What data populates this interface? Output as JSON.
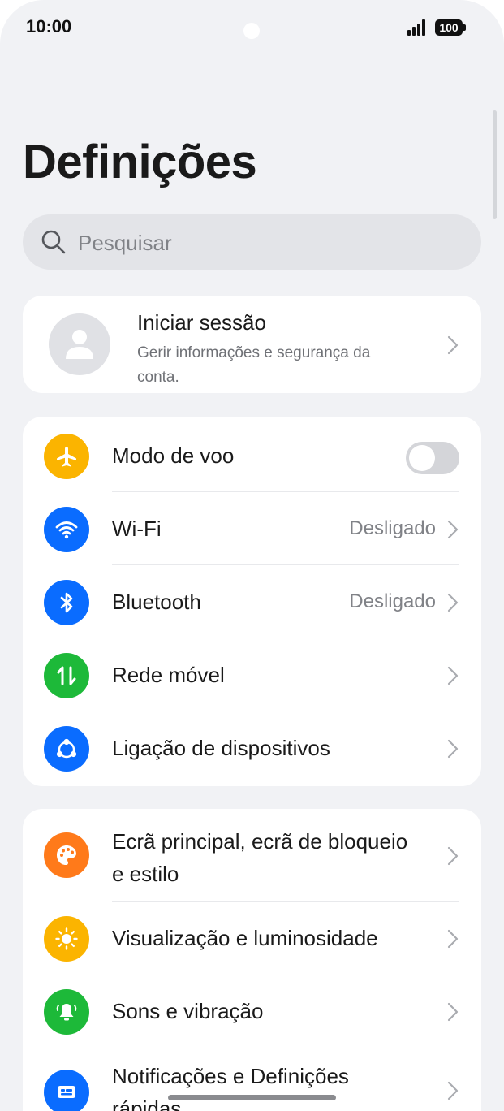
{
  "status_bar": {
    "time": "10:00",
    "battery": "100"
  },
  "page": {
    "title": "Definições"
  },
  "search": {
    "placeholder": "Pesquisar"
  },
  "account": {
    "title": "Iniciar sessão",
    "subtitle": "Gerir informações e segurança da conta."
  },
  "connectivity": {
    "items": [
      {
        "label": "Modo de voo",
        "toggle_on": false,
        "icon": "airplane-icon",
        "color": "#fbb400"
      },
      {
        "label": "Wi-Fi",
        "value": "Desligado",
        "icon": "wifi-icon",
        "color": "#0a6cff"
      },
      {
        "label": "Bluetooth",
        "value": "Desligado",
        "icon": "bluetooth-icon",
        "color": "#0a6cff"
      },
      {
        "label": "Rede móvel",
        "icon": "mobile-data-icon",
        "color": "#1db939"
      },
      {
        "label": "Ligação de dispositivos",
        "icon": "device-connection-icon",
        "color": "#0a6cff"
      }
    ]
  },
  "personalization": {
    "items": [
      {
        "label": "Ecrã principal, ecrã de bloqueio e estilo",
        "icon": "palette-icon",
        "color": "#ff7a1a"
      },
      {
        "label": "Visualização e luminosidade",
        "icon": "brightness-icon",
        "color": "#fbb400"
      },
      {
        "label": "Sons e vibração",
        "icon": "bell-icon",
        "color": "#1db939"
      },
      {
        "label": "Notificações e Definições rápidas",
        "icon": "notification-icon",
        "color": "#0a6cff"
      }
    ]
  }
}
